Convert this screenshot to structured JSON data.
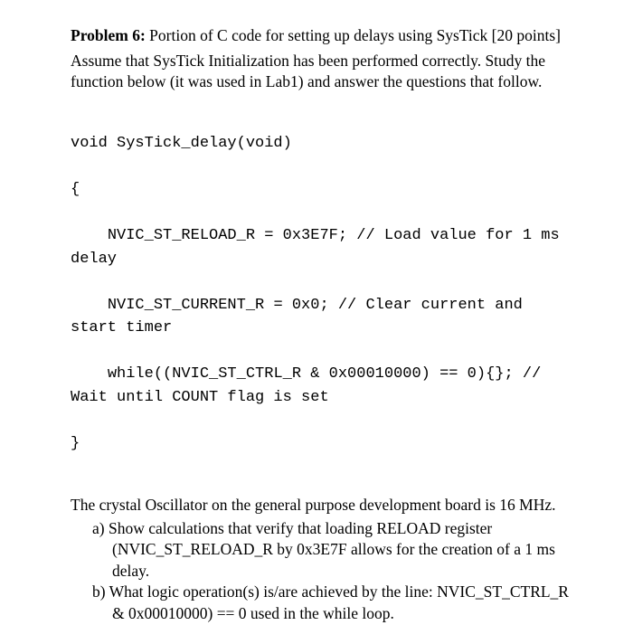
{
  "header": {
    "problem_label": "Problem 6:",
    "problem_title": " Portion of C code for setting up delays using SysTick [20 points]"
  },
  "intro": {
    "line1": "Assume that SysTick Initialization has been performed correctly. Study the function below (it was used in Lab1) and answer the questions that follow."
  },
  "code": {
    "line1": "void SysTick_delay(void)",
    "line2": "{",
    "line3": "    NVIC_ST_RELOAD_R = 0x3E7F; // Load value for 1 ms delay",
    "line4": "    NVIC_ST_CURRENT_R = 0x0; // Clear current and start timer",
    "line5": "    while((NVIC_ST_CTRL_R & 0x00010000) == 0){}; // Wait until COUNT flag is set",
    "line6": "}"
  },
  "question_setup": "The crystal Oscillator on the general purpose development board is 16 MHz.",
  "parts": {
    "a": "a) Show calculations that verify that loading RELOAD register (NVIC_ST_RELOAD_R by 0x3E7F allows for the creation of a 1 ms delay.",
    "b": "b) What logic operation(s) is/are achieved by the line: NVIC_ST_CTRL_R & 0x00010000) == 0 used in the while loop."
  }
}
